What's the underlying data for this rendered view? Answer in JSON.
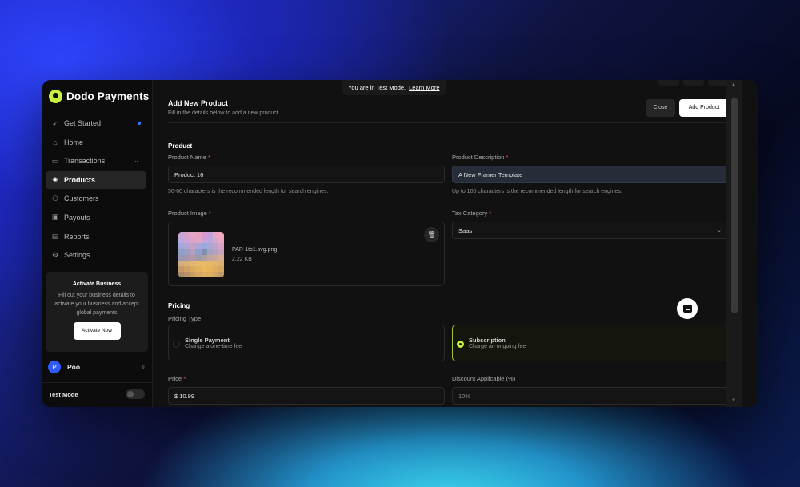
{
  "brand": {
    "name": "Dodo Payments"
  },
  "sidebar": {
    "items": [
      {
        "label": "Get Started",
        "icon": "rocket-icon"
      },
      {
        "label": "Home",
        "icon": "home-icon"
      },
      {
        "label": "Transactions",
        "icon": "card-icon"
      },
      {
        "label": "Products",
        "icon": "box-icon",
        "active": true
      },
      {
        "label": "Customers",
        "icon": "users-icon"
      },
      {
        "label": "Payouts",
        "icon": "wallet-icon"
      },
      {
        "label": "Reports",
        "icon": "report-icon"
      },
      {
        "label": "Settings",
        "icon": "gear-icon"
      }
    ],
    "activate": {
      "title": "Activate Business",
      "text": "Fill out your business details to activate your business and accept global payments",
      "button": "Activate Now"
    },
    "user": {
      "initial": "P",
      "name": "Poo"
    },
    "test_mode_label": "Test Mode"
  },
  "banner": {
    "text": "You are in Test Mode.",
    "link": "Learn More"
  },
  "header": {
    "title": "Add New Product",
    "subtitle": "Fill in the details below to add a new product.",
    "close_label": "Close",
    "add_label": "Add Product"
  },
  "product": {
    "section": "Product",
    "name_label": "Product Name",
    "name_value": "Product 16",
    "name_hint": "50-60 characters is the recommended length for search engines.",
    "desc_label": "Product Description",
    "desc_value": "A  New Framer Template",
    "desc_hint": "Up to 100 characters is the recommended length for search engines.",
    "image_label": "Product Image",
    "image_file": "PAR-1to1.svg.png",
    "image_size": "2.22 KB",
    "tax_label": "Tax Category",
    "tax_value": "Saas",
    "required_mark": "*"
  },
  "pricing": {
    "section": "Pricing",
    "type_label": "Pricing Type",
    "options": [
      {
        "title": "Single Payment",
        "subtitle": "Change a one-time fee",
        "selected": false
      },
      {
        "title": "Subscription",
        "subtitle": "Charge an ongoing fee",
        "selected": true
      }
    ],
    "price_label": "Price",
    "price_value": "$ 10.99",
    "discount_label": "Discount Applicable (%)",
    "discount_placeholder": "10%"
  },
  "colors": {
    "accent": "#c8f03c",
    "primary_button": "#ffffff",
    "status_dot": "#2f7bff"
  }
}
